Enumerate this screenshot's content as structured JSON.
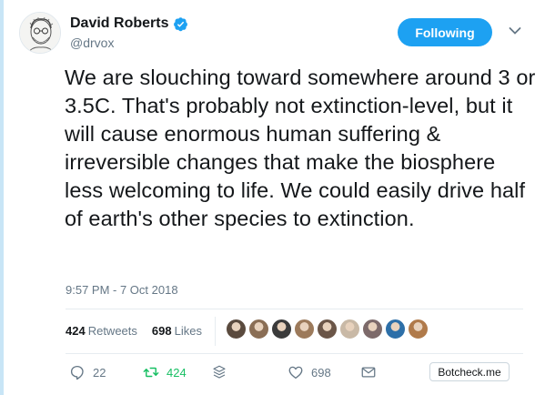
{
  "author": {
    "name": "David Roberts",
    "handle": "@drvox",
    "verified": true
  },
  "follow_button": {
    "label": "Following"
  },
  "tweet": {
    "text": "We are slouching toward somewhere around 3 or 3.5C. That's probably not extinction-level, but it will cause enormous human suffering & irreversible changes that make the biosphere less welcoming to life. We could easily drive half of earth's other species to extinction.",
    "timestamp": "9:57 PM - 7 Oct 2018"
  },
  "stats": {
    "retweets_count": "424",
    "retweets_label": "Retweets",
    "likes_count": "698",
    "likes_label": "Likes"
  },
  "actions": {
    "reply_count": "22",
    "retweet_count": "424",
    "like_count": "698"
  },
  "botcheck": {
    "label": "Botcheck.me"
  },
  "colors": {
    "accent": "#1da1f2",
    "retweet_green": "#17bf63",
    "muted": "#657786",
    "thread_line": "#c8e5f6"
  },
  "liker_avatars": [
    "#5a4a3e",
    "#8a6e55",
    "#3b3b3b",
    "#9c7a5b",
    "#6b5648",
    "#c9b9a6",
    "#7d6a6a",
    "#2d6fa8",
    "#b07a4a"
  ]
}
